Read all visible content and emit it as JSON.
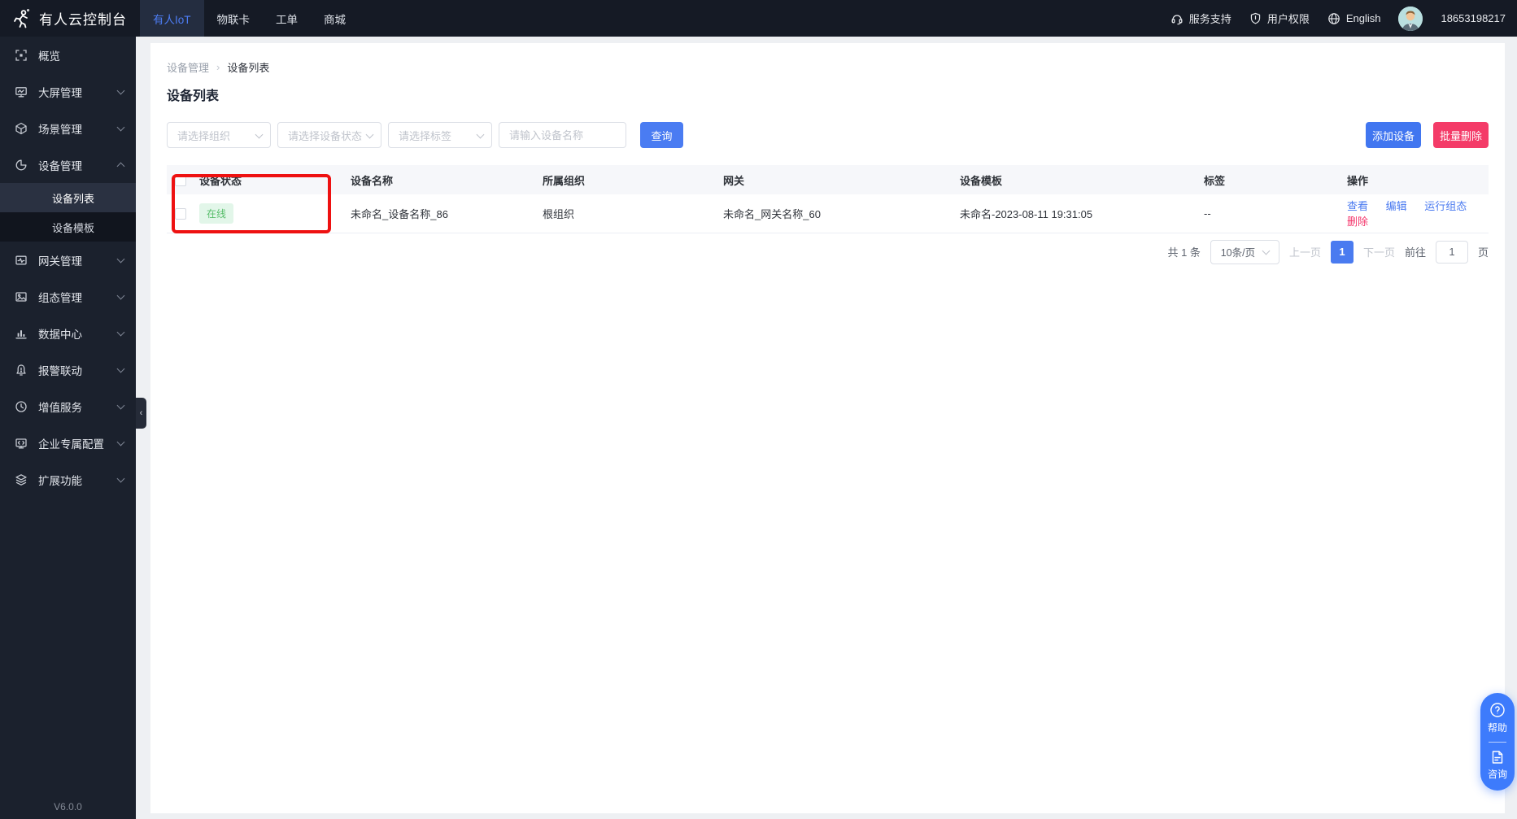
{
  "topbar": {
    "brand": "有人云控制台",
    "tabs": [
      {
        "label": "有人IoT",
        "active": true
      },
      {
        "label": "物联卡",
        "active": false
      },
      {
        "label": "工单",
        "active": false
      },
      {
        "label": "商城",
        "active": false
      }
    ],
    "support": "服务支持",
    "permissions": "用户权限",
    "language": "English",
    "phone": "18653198217"
  },
  "sidebar": {
    "items": [
      {
        "label": "概览"
      },
      {
        "label": "大屏管理"
      },
      {
        "label": "场景管理"
      },
      {
        "label": "设备管理",
        "children": [
          {
            "label": "设备列表"
          },
          {
            "label": "设备模板"
          }
        ]
      },
      {
        "label": "网关管理"
      },
      {
        "label": "组态管理"
      },
      {
        "label": "数据中心"
      },
      {
        "label": "报警联动"
      },
      {
        "label": "增值服务"
      },
      {
        "label": "企业专属配置"
      },
      {
        "label": "扩展功能"
      }
    ],
    "version": "V6.0.0"
  },
  "breadcrumb": {
    "parent": "设备管理",
    "separator": "›",
    "current": "设备列表"
  },
  "page": {
    "title": "设备列表"
  },
  "filters": {
    "org_placeholder": "请选择组织",
    "status_placeholder": "请选择设备状态",
    "tag_placeholder": "请选择标签",
    "name_placeholder": "请输入设备名称",
    "search": "查询",
    "add": "添加设备",
    "batch_delete": "批量删除"
  },
  "table": {
    "columns": [
      "设备状态",
      "设备名称",
      "所属组织",
      "网关",
      "设备模板",
      "标签",
      "操作"
    ],
    "rows": [
      {
        "status": "在线",
        "name": "未命名_设备名称_86",
        "org": "根组织",
        "gateway": "未命名_网关名称_60",
        "template": "未命名-2023-08-11 19:31:05",
        "tags": "--",
        "actions": {
          "view": "查看",
          "edit": "编辑",
          "run_scada": "运行组态",
          "delete": "删除"
        }
      }
    ]
  },
  "pagination": {
    "total": "共 1 条",
    "page_size": "10条/页",
    "prev": "上一页",
    "current_page": "1",
    "next": "下一页",
    "goto_label": "前往",
    "goto_value": "1",
    "goto_unit": "页"
  },
  "float_widget": {
    "help": "帮助",
    "consult": "咨询"
  },
  "colors": {
    "accent": "#4a7bf0",
    "danger": "#f43b68",
    "online_text": "#57bd6a",
    "online_bg": "#e2f6e9",
    "annotation": "#ee1111"
  }
}
